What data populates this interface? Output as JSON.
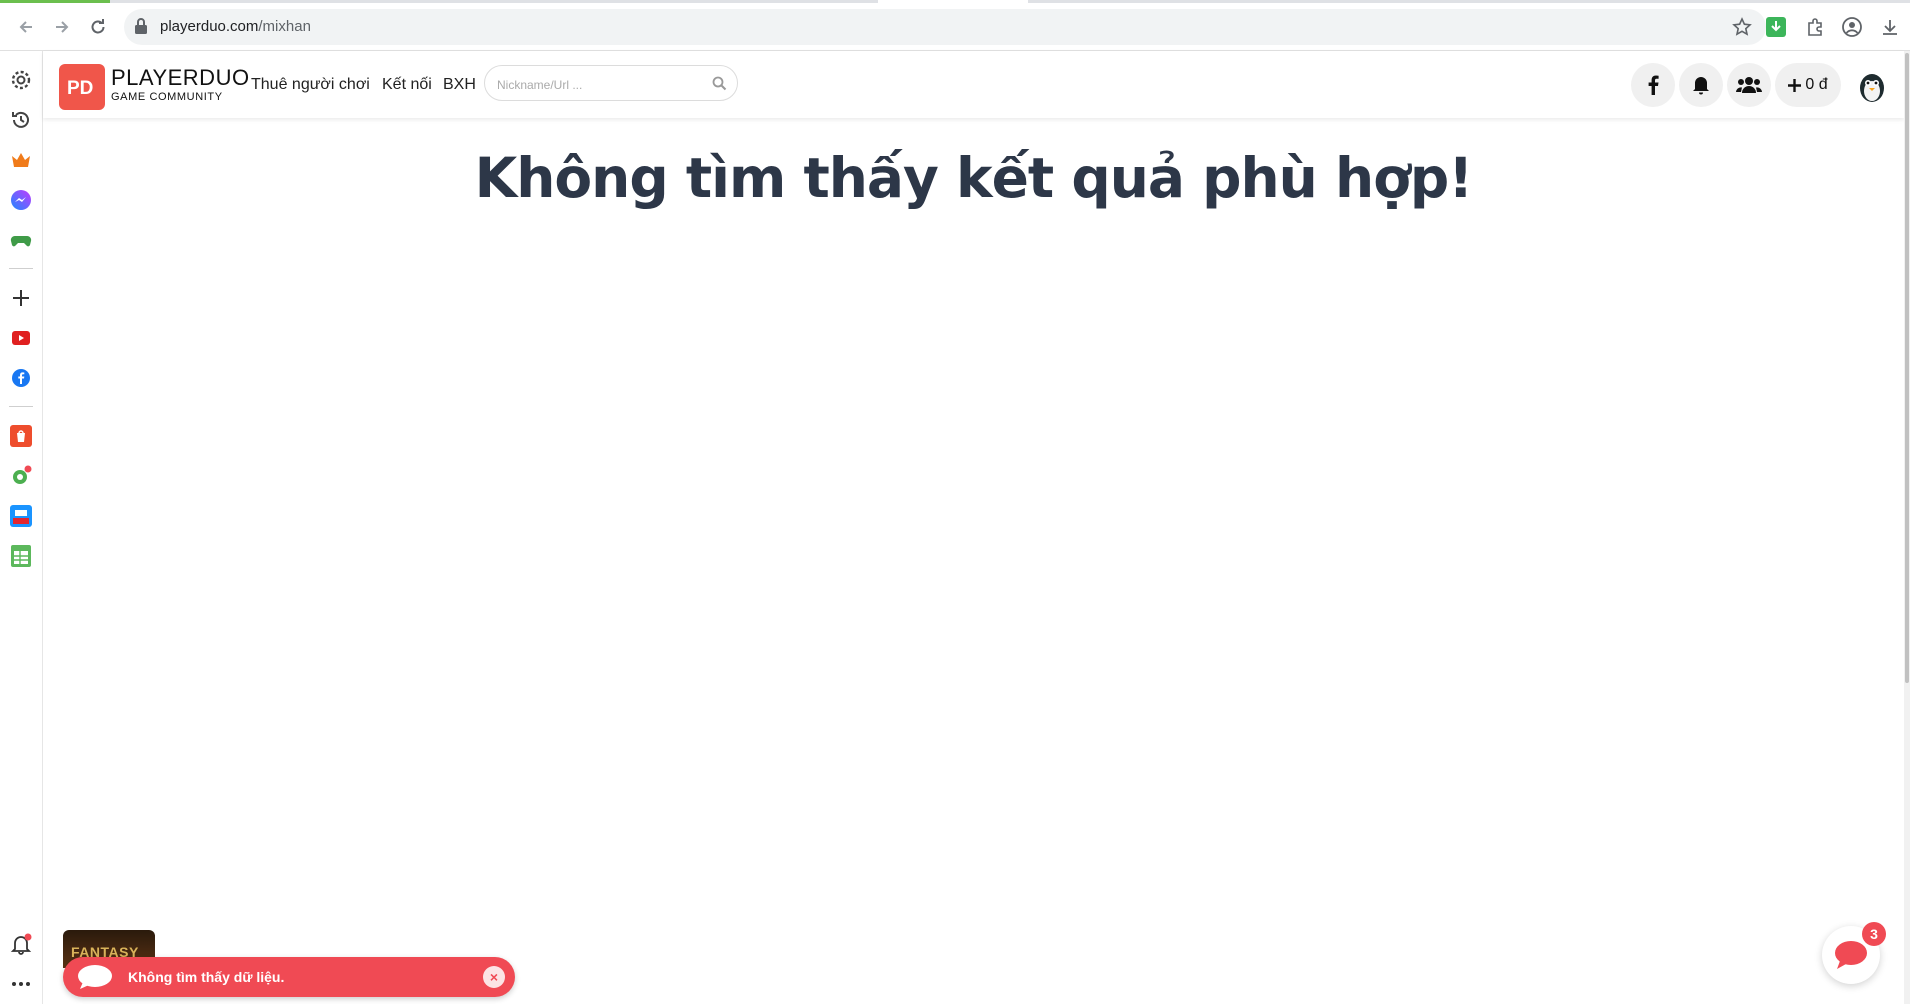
{
  "browser": {
    "url_host": "playerduo.com",
    "url_path": "/mixhan"
  },
  "header": {
    "logo_mark": "PD",
    "logo_title": "PLAYERDUO",
    "logo_subtitle": "GAME COMMUNITY",
    "nav": [
      {
        "label": "Thuê người chơi"
      },
      {
        "label": "Kết nối"
      },
      {
        "label": "BXH"
      }
    ],
    "search_placeholder": "Nickname/Url ...",
    "wallet": "0 đ"
  },
  "main": {
    "title": "Không tìm thấy kết quả phù hợp!"
  },
  "banner": {
    "label": "FANTASY"
  },
  "toast": {
    "message": "Không tìm thấy dữ liệu.",
    "close": "×"
  },
  "chat": {
    "badge": "3"
  },
  "colors": {
    "brand": "#f0564a",
    "toast": "#f04a54",
    "title": "#2d3748"
  }
}
